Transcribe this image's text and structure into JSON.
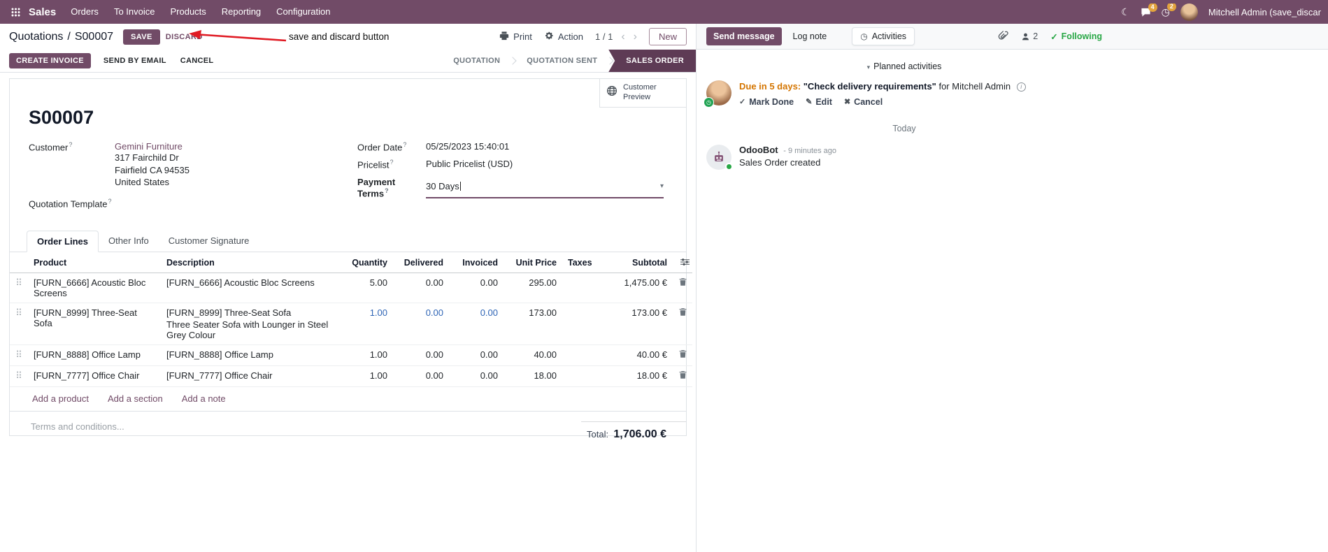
{
  "colors": {
    "accent": "#714B67",
    "active_state_bg": "#5E3B55",
    "modified_value_blue": "#2E64B5",
    "annotation_red": "#E01B24",
    "following_green": "#28A745",
    "activity_due_orange": "#D47500"
  },
  "navbar": {
    "brand": "Sales",
    "menus": [
      "Orders",
      "To Invoice",
      "Products",
      "Reporting",
      "Configuration"
    ],
    "messages_badge": "4",
    "activities_badge": "2",
    "user_name": "Mitchell Admin (save_discar"
  },
  "control_panel": {
    "breadcrumb_parent": "Quotations",
    "breadcrumb_separator": "/",
    "breadcrumb_current": "S00007",
    "save_label": "SAVE",
    "discard_label": "DISCARD",
    "annotation_text": "save and discard button",
    "print_label": "Print",
    "action_label": "Action",
    "pager_value": "1 / 1",
    "new_label": "New"
  },
  "statusbar": {
    "create_invoice_label": "CREATE INVOICE",
    "send_by_email_label": "SEND BY EMAIL",
    "cancel_label": "CANCEL",
    "states": [
      "QUOTATION",
      "QUOTATION SENT",
      "SALES ORDER"
    ]
  },
  "form": {
    "customer_preview_label": "Customer Preview",
    "title": "S00007",
    "help_marker": "?",
    "customer_label": "Customer",
    "customer_name": "Gemini Furniture",
    "customer_address": [
      "317 Fairchild Dr",
      "Fairfield CA 94535",
      "United States"
    ],
    "quotation_template_label": "Quotation Template",
    "order_date_label": "Order Date",
    "order_date_value": "05/25/2023 15:40:01",
    "pricelist_label": "Pricelist",
    "pricelist_value": "Public Pricelist (USD)",
    "payment_terms_label": "Payment Terms",
    "payment_terms_value": "30 Days",
    "tabs": [
      "Order Lines",
      "Other Info",
      "Customer Signature"
    ],
    "table": {
      "headers": [
        "Product",
        "Description",
        "Quantity",
        "Delivered",
        "Invoiced",
        "Unit Price",
        "Taxes",
        "Subtotal"
      ],
      "rows": [
        {
          "product": "[FURN_6666] Acoustic Bloc Screens",
          "description": "[FURN_6666] Acoustic Bloc Screens",
          "description_line2": "",
          "quantity": "5.00",
          "delivered": "0.00",
          "invoiced": "0.00",
          "unit_price": "295.00",
          "taxes": "",
          "subtotal": "1,475.00 €"
        },
        {
          "product": "[FURN_8999] Three-Seat Sofa",
          "description": "[FURN_8999] Three-Seat Sofa",
          "description_line2": "Three Seater Sofa with Lounger in Steel Grey Colour",
          "quantity": "1.00",
          "delivered": "0.00",
          "invoiced": "0.00",
          "unit_price": "173.00",
          "taxes": "",
          "subtotal": "173.00 €"
        },
        {
          "product": "[FURN_8888] Office Lamp",
          "description": "[FURN_8888] Office Lamp",
          "description_line2": "",
          "quantity": "1.00",
          "delivered": "0.00",
          "invoiced": "0.00",
          "unit_price": "40.00",
          "taxes": "",
          "subtotal": "40.00 €"
        },
        {
          "product": "[FURN_7777] Office Chair",
          "description": "[FURN_7777] Office Chair",
          "description_line2": "",
          "quantity": "1.00",
          "delivered": "0.00",
          "invoiced": "0.00",
          "unit_price": "18.00",
          "taxes": "",
          "subtotal": "18.00 €"
        }
      ],
      "add_product_label": "Add a product",
      "add_section_label": "Add a section",
      "add_note_label": "Add a note"
    },
    "terms_placeholder": "Terms and conditions...",
    "total_label": "Total:",
    "total_value": "1,706.00 €"
  },
  "chatter": {
    "send_message_label": "Send message",
    "log_note_label": "Log note",
    "activities_label": "Activities",
    "followers_count": "2",
    "following_label": "Following",
    "planned_activities_header": "Planned activities",
    "activity": {
      "due_text": "Due in 5 days:",
      "summary": "\"Check delivery requirements\"",
      "assignee": "for Mitchell Admin",
      "mark_done_label": "Mark Done",
      "edit_label": "Edit",
      "cancel_label": "Cancel"
    },
    "date_divider": "Today",
    "message": {
      "author": "OdooBot",
      "time": "- 9 minutes ago",
      "body": "Sales Order created"
    }
  }
}
